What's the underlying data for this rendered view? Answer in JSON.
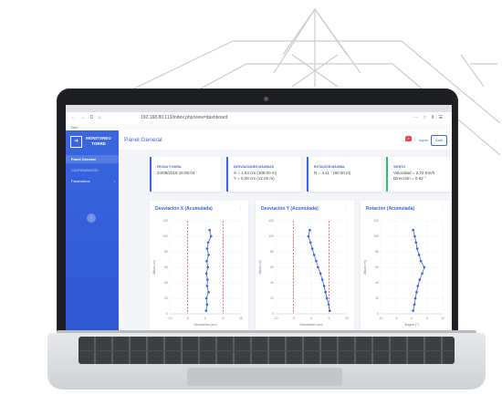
{
  "browser": {
    "nav_glyphs": "← → C ⌂",
    "url": "192.168.80.113/index.php/view=dashboard",
    "toolbar_glyphs": "⋯ ☆ ⫴ ☰",
    "bookmark": "Dev"
  },
  "sidebar": {
    "brand_line1": "MONITOREO",
    "brand_line2": "TORRE",
    "active_item": "Panel General",
    "section": "CONFIGURACIÓN",
    "item": "Parámetros",
    "toggle": "‹"
  },
  "header": {
    "title": "Panel General",
    "user": "super",
    "logout_label": "Salir"
  },
  "stats": [
    {
      "label": "FECHA Y HORA",
      "line1": "24/08/2019 15:05:04",
      "line2": ""
    },
    {
      "label": "DESVIACIONES MÁXIMAS",
      "line1": "X = 1.63 cm (108.00 m)",
      "line2": "Y = 0.49 cm (12.00 m)"
    },
    {
      "label": "ROTACIÓN MÁXIMA",
      "line1": "R = 4.11 ° (60.00 m)",
      "line2": ""
    },
    {
      "label": "VIENTO",
      "line1": "Velocidad = 2.72 Km/h",
      "line2": "Dirección = 0.62 °"
    }
  ],
  "colors": {
    "accent": "#3a66e0",
    "danger": "#e94b4b",
    "stat4": "#2fbf71"
  },
  "chart_data": [
    {
      "type": "line",
      "title": "Desviación X (Acumulada)",
      "xlabel": "Desviación (cm)",
      "ylabel": "Altura (m)",
      "xlim": [
        -10,
        10
      ],
      "ylim": [
        0,
        120
      ],
      "xticks": [
        -10,
        -5,
        0,
        5,
        10
      ],
      "yticks": [
        0,
        20,
        40,
        60,
        80,
        100,
        120
      ],
      "limits": [
        -5,
        5
      ],
      "x": [
        1.2,
        1.6,
        0.8,
        0.5,
        0.9,
        0.4,
        0.7,
        0.3,
        0.6,
        0.5,
        0.9,
        0.3,
        0.5,
        0.2
      ],
      "y": [
        108,
        100,
        92,
        84,
        76,
        68,
        60,
        52,
        44,
        36,
        28,
        20,
        12,
        4
      ]
    },
    {
      "type": "line",
      "title": "Desviación Y (Acumulada)",
      "xlabel": "Desviación (cm)",
      "ylabel": "Altura (m)",
      "xlim": [
        -10,
        10
      ],
      "ylim": [
        0,
        120
      ],
      "xticks": [
        -10,
        -5,
        0,
        5,
        10
      ],
      "yticks": [
        0,
        20,
        40,
        60,
        80,
        100,
        120
      ],
      "limits": [
        -5,
        5
      ],
      "x": [
        -0.4,
        -0.8,
        -0.2,
        0.3,
        0.8,
        1.4,
        1.9,
        2.6,
        3.1,
        3.6,
        4.0,
        4.4,
        4.9,
        5.2
      ],
      "y": [
        108,
        100,
        92,
        84,
        76,
        68,
        60,
        52,
        44,
        36,
        28,
        20,
        12,
        4
      ]
    },
    {
      "type": "line",
      "title": "Rotación (Acumulada)",
      "xlabel": "Ángulo (°)",
      "ylabel": "Altura (m)",
      "xlim": [
        -10,
        10
      ],
      "ylim": [
        0,
        120
      ],
      "xticks": [
        -10,
        -5,
        0,
        5,
        10
      ],
      "yticks": [
        0,
        20,
        40,
        60,
        80,
        100,
        120
      ],
      "limits": [],
      "x": [
        0.5,
        1.0,
        1.4,
        1.8,
        2.4,
        3.0,
        4.1,
        3.4,
        2.6,
        2.0,
        1.6,
        1.2,
        0.9,
        0.5
      ],
      "y": [
        108,
        100,
        92,
        84,
        76,
        68,
        60,
        52,
        44,
        36,
        28,
        20,
        12,
        4
      ]
    }
  ]
}
